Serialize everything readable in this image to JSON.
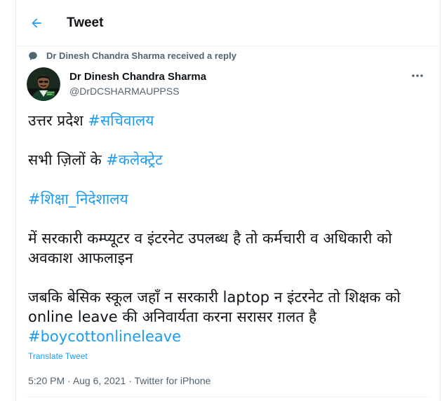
{
  "header": {
    "title": "Tweet",
    "back_icon": "arrow-left-icon"
  },
  "social_context": {
    "icon": "reply-bubble-icon",
    "text": "Dr Dinesh Chandra Sharma received a reply"
  },
  "author": {
    "name": "Dr Dinesh Chandra Sharma",
    "handle": "@DrDCSHARMAUPPSS"
  },
  "tweet": {
    "para1": {
      "text": "उत्तर प्रदेश ",
      "hashtag": "#सचिवालय"
    },
    "para2": {
      "text": "सभी ज़िलों के ",
      "hashtag": "#कलेक्ट्रेट"
    },
    "para3": {
      "hashtag": "#शिक्षा_निदेशालय"
    },
    "para4": {
      "text": "में सरकारी कम्प्यूटर व इंटरनेट उपलब्ध है तो कर्मचारी व अधिकारी को अवकाश आफलाइन"
    },
    "para5": {
      "text": "जबकि बेसिक स्कूल जहाँ न सरकारी laptop न इंटरनेट तो शिक्षक को online leave की अनिवार्यता करना सरासर ग़लत है",
      "hashtag": "#boycottonlineleave"
    },
    "translate_label": "Translate Tweet",
    "time": "5:20 PM",
    "separator": " · ",
    "date": "Aug 6, 2021",
    "source": "Twitter for iPhone"
  },
  "colors": {
    "accent": "#1d9bf0",
    "secondary_text": "#536471",
    "primary_text": "#0f1419"
  }
}
